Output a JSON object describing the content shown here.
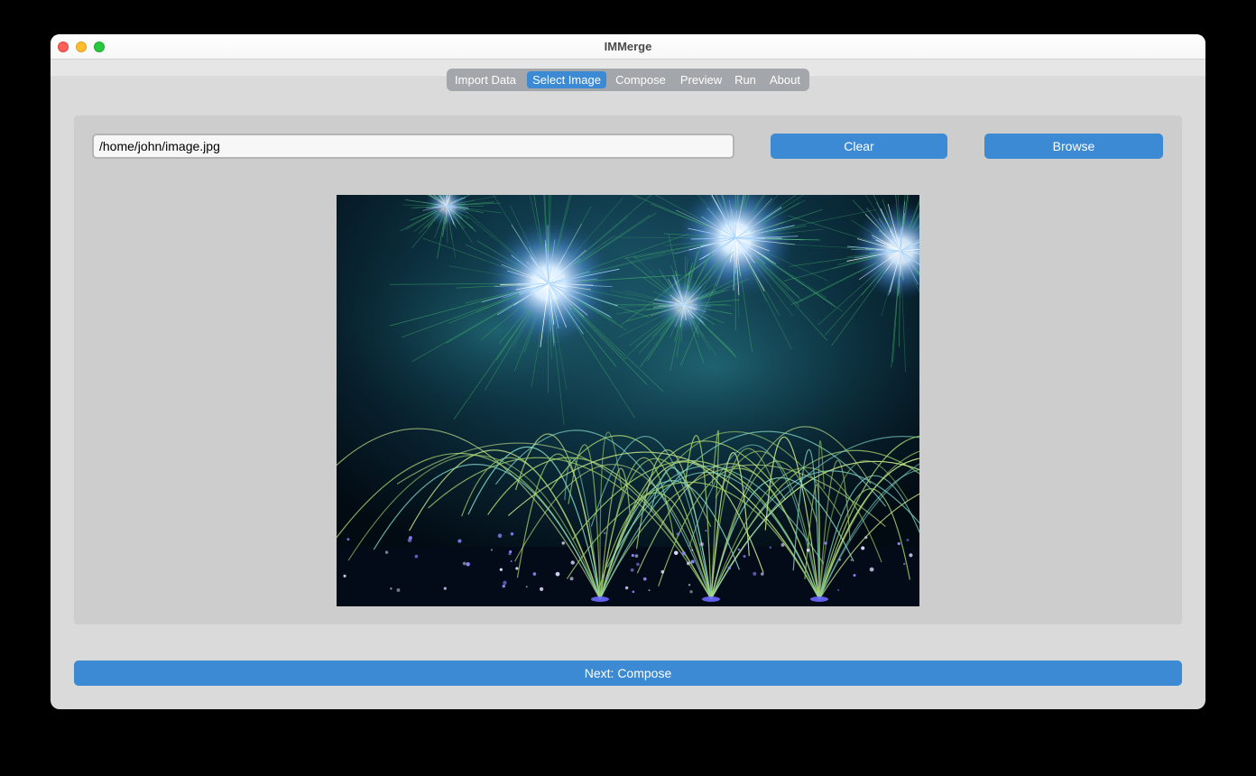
{
  "window": {
    "title": "IMMerge"
  },
  "tabs": [
    {
      "label": "Import Data",
      "active": false
    },
    {
      "label": "Select Image",
      "active": true
    },
    {
      "label": "Compose",
      "active": false
    },
    {
      "label": "Preview",
      "active": false
    },
    {
      "label": "Run",
      "active": false
    },
    {
      "label": "About",
      "active": false
    }
  ],
  "image_select": {
    "path_value": "/home/john/image.jpg",
    "clear_label": "Clear",
    "browse_label": "Browse"
  },
  "preview_image": {
    "subject": "fireworks"
  },
  "footer": {
    "next_label": "Next: Compose"
  },
  "colors": {
    "accent": "#3b8ad3",
    "tabbar": "#a3a6aa",
    "panel": "#cdcdcd",
    "window": "#dadada"
  }
}
